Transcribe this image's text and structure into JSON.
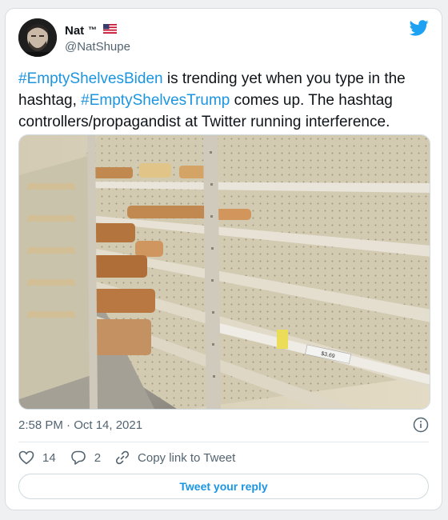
{
  "author": {
    "display_name": "Nat",
    "tm_mark": "™",
    "flag": "🇺🇸",
    "handle": "@NatShupe"
  },
  "tweet": {
    "hashtag_1": "#EmptyShelvesBiden",
    "text_1": " is trending yet when you type in the hashtag, ",
    "hashtag_2": "#EmptyShelvesTrump",
    "text_2": " comes up.  The hashtag controllers/propagandist at Twitter running interference."
  },
  "photo": {
    "price_tag_1": "$3.69",
    "price_tag_2": "$3.69"
  },
  "meta": {
    "timestamp": "2:58 PM · Oct 14, 2021"
  },
  "actions": {
    "like_count": "14",
    "reply_count": "2",
    "copy_link_label": "Copy link to Tweet",
    "tweet_reply_label": "Tweet your reply"
  },
  "colors": {
    "link": "#1b95e0",
    "secondary_text": "#536471",
    "twitter_blue": "#1da1f2"
  },
  "icons": [
    "avatar",
    "twitter-bird-icon",
    "info-icon",
    "heart-icon",
    "reply-icon",
    "link-icon"
  ]
}
